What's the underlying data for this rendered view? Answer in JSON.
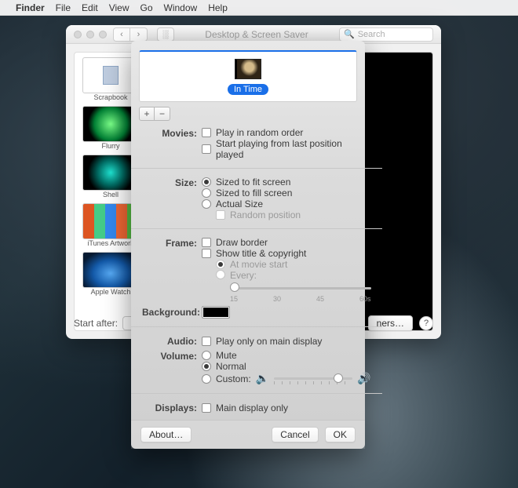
{
  "menubar": {
    "app_name": "Finder",
    "items": [
      "File",
      "Edit",
      "View",
      "Go",
      "Window",
      "Help"
    ]
  },
  "syspref": {
    "title": "Desktop & Screen Saver",
    "search_placeholder": "Search",
    "savers": [
      {
        "label": "Scrapbook"
      },
      {
        "label": "Flurry"
      },
      {
        "label": "Shell"
      },
      {
        "label": "iTunes Artwork"
      },
      {
        "label": "Apple Watch"
      }
    ],
    "start_after_label": "Start after:",
    "corners_button": "ners…",
    "help": "?"
  },
  "sheet": {
    "selected_movie": "In Time",
    "add": "+",
    "remove": "−",
    "sections": {
      "movies": {
        "label": "Movies:",
        "random": "Play in random order",
        "resume": "Start playing from last position played"
      },
      "size": {
        "label": "Size:",
        "fit": "Sized to fit screen",
        "fill": "Sized to fill screen",
        "actual": "Actual Size",
        "random_pos": "Random position"
      },
      "frame": {
        "label": "Frame:",
        "border": "Draw border",
        "title": "Show title & copyright",
        "at_start": "At movie start",
        "every": "Every:",
        "ticks": {
          "a": "15",
          "b": "30",
          "c": "45",
          "d": "60s"
        }
      },
      "background": {
        "label": "Background:"
      },
      "audio": {
        "label": "Audio:",
        "main_only": "Play only on main display"
      },
      "volume": {
        "label": "Volume:",
        "mute": "Mute",
        "normal": "Normal",
        "custom": "Custom:"
      },
      "displays": {
        "label": "Displays:",
        "main_only": "Main display only"
      }
    },
    "buttons": {
      "about": "About…",
      "cancel": "Cancel",
      "ok": "OK"
    }
  }
}
